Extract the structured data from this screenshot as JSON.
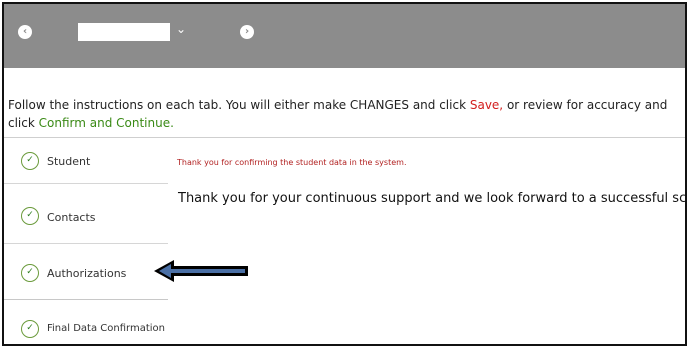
{
  "header": {
    "back_icon": "chevron-left-icon",
    "student_dropdown_icon": "chevron-down-icon",
    "forward_icon": "chevron-right-icon",
    "background_color": "#8c8c8c"
  },
  "instructions": {
    "text_before_save": "Follow the instructions on each tab. You will either make CHANGES and click ",
    "save_label": "Save,",
    "text_between": " or review for accuracy and click ",
    "confirm_label": "Confirm and Continue.",
    "save_color": "#d21d1d",
    "confirm_color": "#3a8a16"
  },
  "sidebar": {
    "items": [
      {
        "label": "Student",
        "icon": "check-circle-icon"
      },
      {
        "label": "Contacts",
        "icon": "check-circle-icon"
      },
      {
        "label": "Authorizations",
        "icon": "check-circle-icon"
      },
      {
        "label": "Final Data Confirmation",
        "icon": "check-circle-icon"
      }
    ]
  },
  "main": {
    "confirmation_message": "Thank you for confirming the student data in the system.",
    "thanks_message": "Thank you for your continuous support and we look forward to a successful school year!"
  },
  "annotation": {
    "arrow_icon": "left-arrow-icon",
    "arrow_color": "#4a6fa5"
  }
}
